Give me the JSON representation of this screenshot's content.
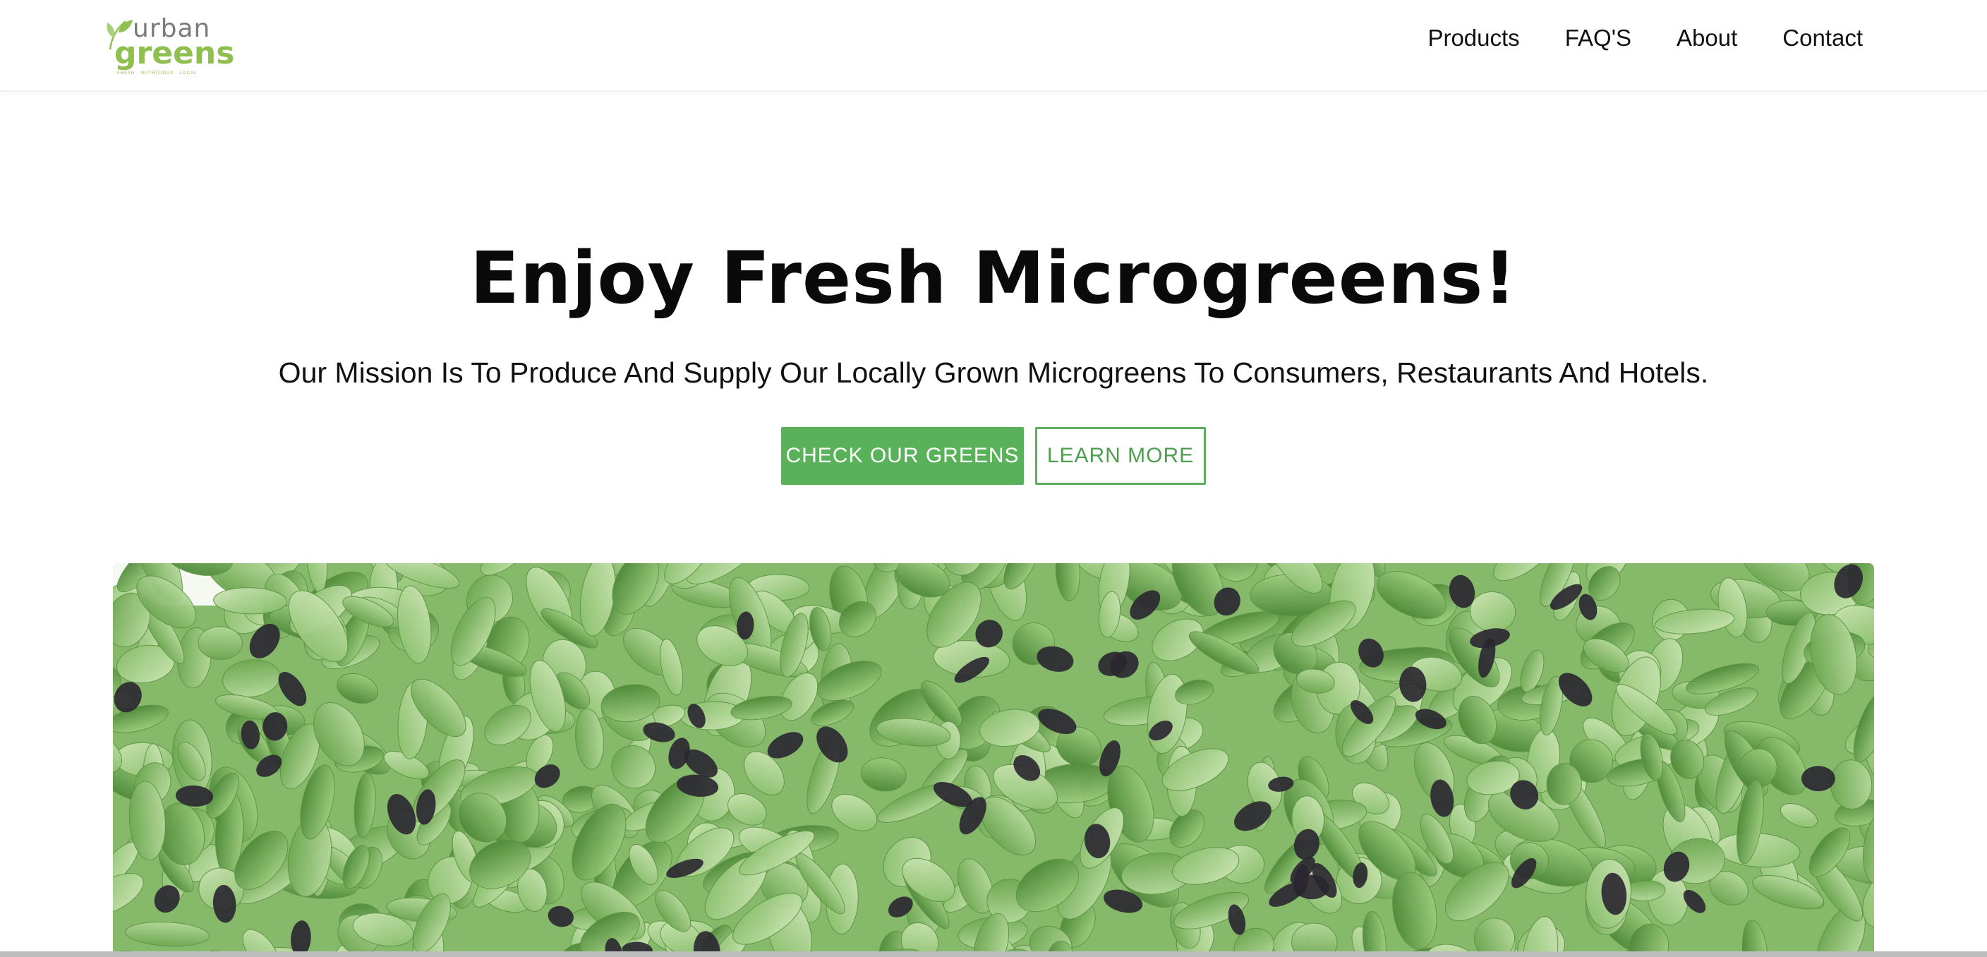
{
  "header": {
    "logo": {
      "word_top": "urban",
      "word_bottom": "greens",
      "tagline": "FRESH · NUTRITIOUS · LOCAL",
      "icon": "leaf-icon",
      "colors": {
        "grey": "#7a7a7a",
        "green": "#8fc04f"
      }
    },
    "nav": [
      {
        "label": "Products"
      },
      {
        "label": "FAQ'S"
      },
      {
        "label": "About"
      },
      {
        "label": "Contact"
      }
    ]
  },
  "hero": {
    "title": "Enjoy Fresh Microgreens!",
    "subtitle": "Our Mission Is To Produce And Supply Our Locally Grown Microgreens To Consumers, Restaurants And Hotels.",
    "primary_button": "CHECK OUR GREENS",
    "secondary_button": "LEARN MORE",
    "image": "sunflower-microgreens-photo"
  },
  "colors": {
    "accent_green": "#59b259",
    "text_dark": "#111111",
    "background": "#ffffff"
  }
}
